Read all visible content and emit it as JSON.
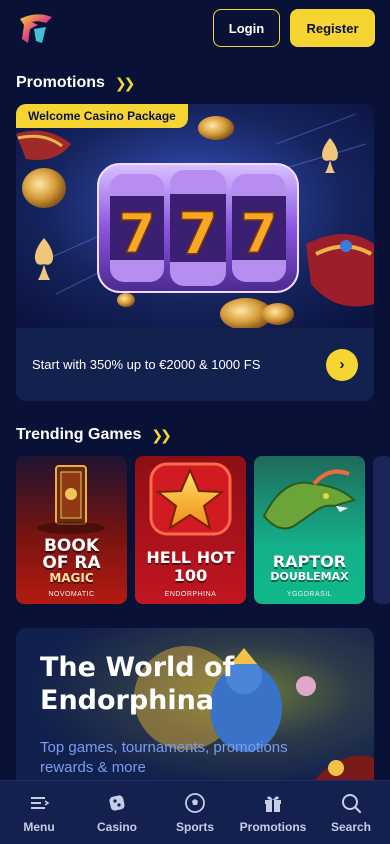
{
  "header": {
    "login_label": "Login",
    "register_label": "Register"
  },
  "promotions": {
    "title": "Promotions",
    "badge": "Welcome Casino Package",
    "offer_text": "Start with 350% up to €2000 & 1000 FS",
    "reels": [
      "7",
      "7",
      "7"
    ]
  },
  "trending": {
    "title": "Trending Games",
    "games": [
      {
        "title_line1": "BOOK",
        "title_line2": "OF RA",
        "title_line3": "MAGIC",
        "provider": "NOVOMATIC"
      },
      {
        "title_line1": "HELL HOT",
        "title_line2": "100",
        "provider": "ENDORPHINA"
      },
      {
        "title_line1": "RAPTOR",
        "title_line2": "DOUBLEMAX",
        "provider": "YGGDRASIL"
      }
    ]
  },
  "banner": {
    "title_line1": "The World of",
    "title_line2": "Endorphina",
    "subtitle": "Top games, tournaments, promotions rewards & more"
  },
  "nav": {
    "items": [
      {
        "label": "Menu",
        "icon": "menu-icon"
      },
      {
        "label": "Casino",
        "icon": "casino-icon"
      },
      {
        "label": "Sports",
        "icon": "soccer-ball-icon"
      },
      {
        "label": "Promotions",
        "icon": "gift-icon"
      },
      {
        "label": "Search",
        "icon": "search-icon"
      }
    ]
  },
  "colors": {
    "background": "#0a1136",
    "accent": "#f6d533",
    "card": "#13214f",
    "subtitle": "#7b9cf0"
  }
}
